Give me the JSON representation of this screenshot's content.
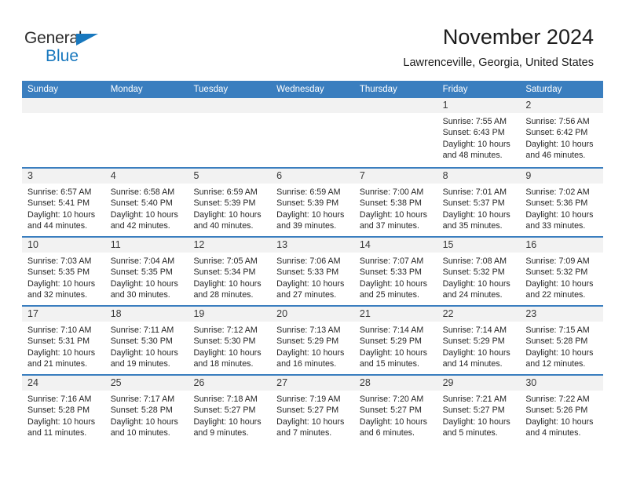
{
  "brand": {
    "name_part1": "General",
    "name_part2": "Blue",
    "accent_color": "#1878be"
  },
  "header": {
    "title": "November 2024",
    "subtitle": "Lawrenceville, Georgia, United States"
  },
  "theme": {
    "header_blue": "#3a7ebf",
    "day_band_gray": "#f2f2f2"
  },
  "weekdays": [
    "Sunday",
    "Monday",
    "Tuesday",
    "Wednesday",
    "Thursday",
    "Friday",
    "Saturday"
  ],
  "weeks": [
    [
      {
        "day": "",
        "lines": []
      },
      {
        "day": "",
        "lines": []
      },
      {
        "day": "",
        "lines": []
      },
      {
        "day": "",
        "lines": []
      },
      {
        "day": "",
        "lines": []
      },
      {
        "day": "1",
        "lines": [
          "Sunrise: 7:55 AM",
          "Sunset: 6:43 PM",
          "Daylight: 10 hours",
          "and 48 minutes."
        ]
      },
      {
        "day": "2",
        "lines": [
          "Sunrise: 7:56 AM",
          "Sunset: 6:42 PM",
          "Daylight: 10 hours",
          "and 46 minutes."
        ]
      }
    ],
    [
      {
        "day": "3",
        "lines": [
          "Sunrise: 6:57 AM",
          "Sunset: 5:41 PM",
          "Daylight: 10 hours",
          "and 44 minutes."
        ]
      },
      {
        "day": "4",
        "lines": [
          "Sunrise: 6:58 AM",
          "Sunset: 5:40 PM",
          "Daylight: 10 hours",
          "and 42 minutes."
        ]
      },
      {
        "day": "5",
        "lines": [
          "Sunrise: 6:59 AM",
          "Sunset: 5:39 PM",
          "Daylight: 10 hours",
          "and 40 minutes."
        ]
      },
      {
        "day": "6",
        "lines": [
          "Sunrise: 6:59 AM",
          "Sunset: 5:39 PM",
          "Daylight: 10 hours",
          "and 39 minutes."
        ]
      },
      {
        "day": "7",
        "lines": [
          "Sunrise: 7:00 AM",
          "Sunset: 5:38 PM",
          "Daylight: 10 hours",
          "and 37 minutes."
        ]
      },
      {
        "day": "8",
        "lines": [
          "Sunrise: 7:01 AM",
          "Sunset: 5:37 PM",
          "Daylight: 10 hours",
          "and 35 minutes."
        ]
      },
      {
        "day": "9",
        "lines": [
          "Sunrise: 7:02 AM",
          "Sunset: 5:36 PM",
          "Daylight: 10 hours",
          "and 33 minutes."
        ]
      }
    ],
    [
      {
        "day": "10",
        "lines": [
          "Sunrise: 7:03 AM",
          "Sunset: 5:35 PM",
          "Daylight: 10 hours",
          "and 32 minutes."
        ]
      },
      {
        "day": "11",
        "lines": [
          "Sunrise: 7:04 AM",
          "Sunset: 5:35 PM",
          "Daylight: 10 hours",
          "and 30 minutes."
        ]
      },
      {
        "day": "12",
        "lines": [
          "Sunrise: 7:05 AM",
          "Sunset: 5:34 PM",
          "Daylight: 10 hours",
          "and 28 minutes."
        ]
      },
      {
        "day": "13",
        "lines": [
          "Sunrise: 7:06 AM",
          "Sunset: 5:33 PM",
          "Daylight: 10 hours",
          "and 27 minutes."
        ]
      },
      {
        "day": "14",
        "lines": [
          "Sunrise: 7:07 AM",
          "Sunset: 5:33 PM",
          "Daylight: 10 hours",
          "and 25 minutes."
        ]
      },
      {
        "day": "15",
        "lines": [
          "Sunrise: 7:08 AM",
          "Sunset: 5:32 PM",
          "Daylight: 10 hours",
          "and 24 minutes."
        ]
      },
      {
        "day": "16",
        "lines": [
          "Sunrise: 7:09 AM",
          "Sunset: 5:32 PM",
          "Daylight: 10 hours",
          "and 22 minutes."
        ]
      }
    ],
    [
      {
        "day": "17",
        "lines": [
          "Sunrise: 7:10 AM",
          "Sunset: 5:31 PM",
          "Daylight: 10 hours",
          "and 21 minutes."
        ]
      },
      {
        "day": "18",
        "lines": [
          "Sunrise: 7:11 AM",
          "Sunset: 5:30 PM",
          "Daylight: 10 hours",
          "and 19 minutes."
        ]
      },
      {
        "day": "19",
        "lines": [
          "Sunrise: 7:12 AM",
          "Sunset: 5:30 PM",
          "Daylight: 10 hours",
          "and 18 minutes."
        ]
      },
      {
        "day": "20",
        "lines": [
          "Sunrise: 7:13 AM",
          "Sunset: 5:29 PM",
          "Daylight: 10 hours",
          "and 16 minutes."
        ]
      },
      {
        "day": "21",
        "lines": [
          "Sunrise: 7:14 AM",
          "Sunset: 5:29 PM",
          "Daylight: 10 hours",
          "and 15 minutes."
        ]
      },
      {
        "day": "22",
        "lines": [
          "Sunrise: 7:14 AM",
          "Sunset: 5:29 PM",
          "Daylight: 10 hours",
          "and 14 minutes."
        ]
      },
      {
        "day": "23",
        "lines": [
          "Sunrise: 7:15 AM",
          "Sunset: 5:28 PM",
          "Daylight: 10 hours",
          "and 12 minutes."
        ]
      }
    ],
    [
      {
        "day": "24",
        "lines": [
          "Sunrise: 7:16 AM",
          "Sunset: 5:28 PM",
          "Daylight: 10 hours",
          "and 11 minutes."
        ]
      },
      {
        "day": "25",
        "lines": [
          "Sunrise: 7:17 AM",
          "Sunset: 5:28 PM",
          "Daylight: 10 hours",
          "and 10 minutes."
        ]
      },
      {
        "day": "26",
        "lines": [
          "Sunrise: 7:18 AM",
          "Sunset: 5:27 PM",
          "Daylight: 10 hours",
          "and 9 minutes."
        ]
      },
      {
        "day": "27",
        "lines": [
          "Sunrise: 7:19 AM",
          "Sunset: 5:27 PM",
          "Daylight: 10 hours",
          "and 7 minutes."
        ]
      },
      {
        "day": "28",
        "lines": [
          "Sunrise: 7:20 AM",
          "Sunset: 5:27 PM",
          "Daylight: 10 hours",
          "and 6 minutes."
        ]
      },
      {
        "day": "29",
        "lines": [
          "Sunrise: 7:21 AM",
          "Sunset: 5:27 PM",
          "Daylight: 10 hours",
          "and 5 minutes."
        ]
      },
      {
        "day": "30",
        "lines": [
          "Sunrise: 7:22 AM",
          "Sunset: 5:26 PM",
          "Daylight: 10 hours",
          "and 4 minutes."
        ]
      }
    ]
  ]
}
